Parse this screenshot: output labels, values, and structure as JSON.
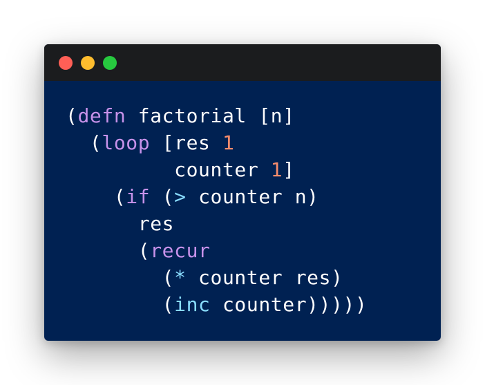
{
  "colors": {
    "background": "#002152",
    "titlebar": "#1b1c1e",
    "close": "#ff5f56",
    "minimize": "#ffbd2e",
    "maximize": "#27c93f",
    "text": "#ffffff",
    "keyword": "#c792ea",
    "builtin": "#89ddff",
    "number": "#f78c6c"
  },
  "window": {
    "controls": [
      {
        "name": "close-button",
        "color": "#ff5f56"
      },
      {
        "name": "minimize-button",
        "color": "#ffbd2e"
      },
      {
        "name": "maximize-button",
        "color": "#27c93f"
      }
    ]
  },
  "code": {
    "lines": [
      [
        {
          "t": "("
        },
        {
          "t": "defn",
          "k": "keyword"
        },
        {
          "t": " factorial [n]"
        }
      ],
      [
        {
          "t": "  ("
        },
        {
          "t": "loop",
          "k": "keyword"
        },
        {
          "t": " [res "
        },
        {
          "t": "1",
          "k": "number"
        }
      ],
      [
        {
          "t": "         counter "
        },
        {
          "t": "1",
          "k": "number"
        },
        {
          "t": "]"
        }
      ],
      [
        {
          "t": "    ("
        },
        {
          "t": "if",
          "k": "keyword"
        },
        {
          "t": " ("
        },
        {
          "t": ">",
          "k": "builtin"
        },
        {
          "t": " counter n)"
        }
      ],
      [
        {
          "t": "      res"
        }
      ],
      [
        {
          "t": "      ("
        },
        {
          "t": "recur",
          "k": "keyword"
        }
      ],
      [
        {
          "t": "        ("
        },
        {
          "t": "*",
          "k": "builtin"
        },
        {
          "t": " counter res)"
        }
      ],
      [
        {
          "t": "        ("
        },
        {
          "t": "inc",
          "k": "builtin"
        },
        {
          "t": " counter)))))"
        }
      ]
    ]
  }
}
